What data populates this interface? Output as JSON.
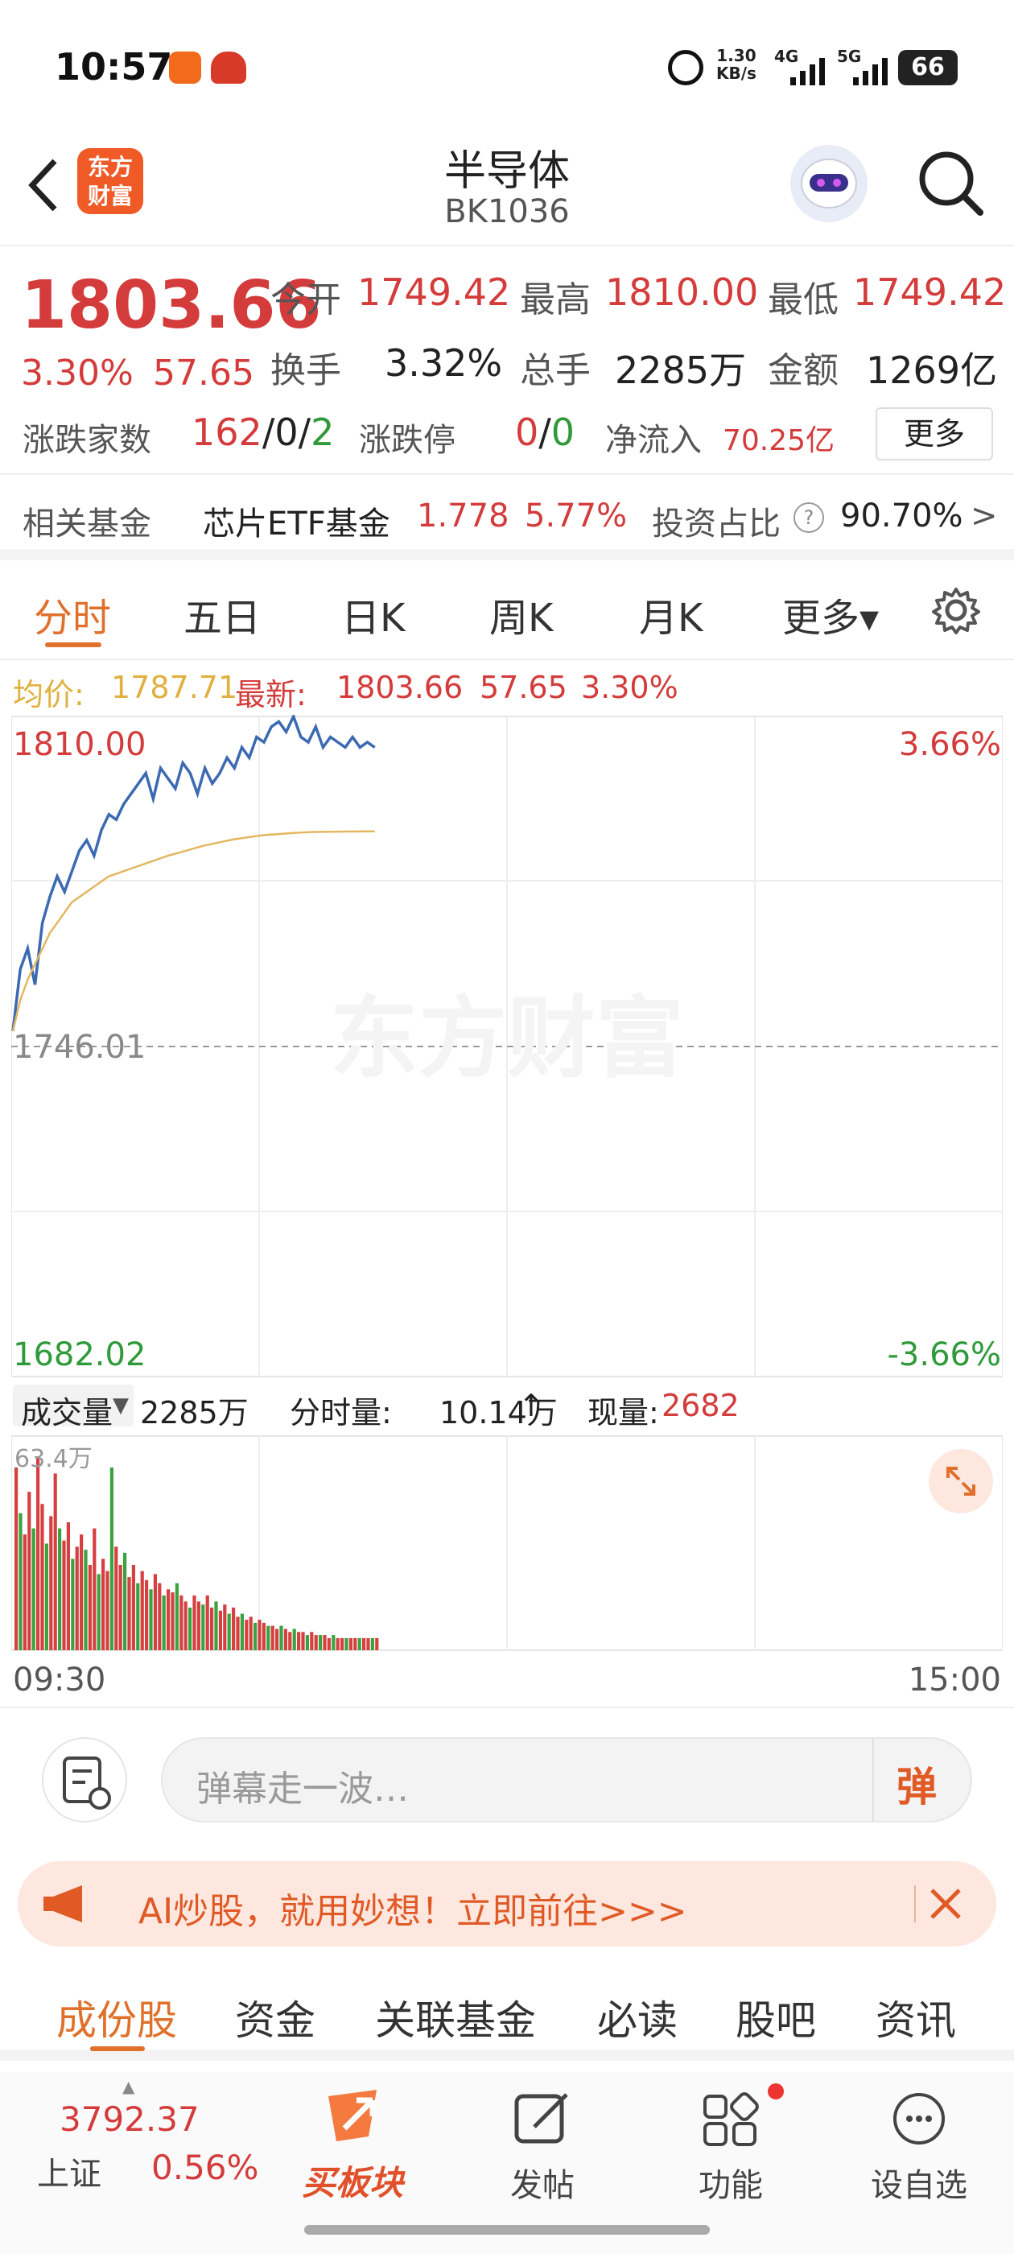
{
  "status": {
    "time": "10:57",
    "speed": "1.30",
    "speed_unit": "KB/s",
    "net1": "4G",
    "net2": "5G",
    "battery": "66"
  },
  "nav": {
    "logo": "东方财富",
    "title": "半导体",
    "code": "BK1036"
  },
  "quote": {
    "price": "1803.66",
    "change_pct": "3.30%",
    "change": "57.65",
    "open_label": "今开",
    "open": "1749.42",
    "high_label": "最高",
    "high": "1810.00",
    "low_label": "最低",
    "low": "1749.42",
    "turnover_label": "换手",
    "turnover": "3.32%",
    "volume_label": "总手",
    "volume": "2285万",
    "amount_label": "金额",
    "amount": "1269亿",
    "updown_label": "涨跌家数",
    "up": "162",
    "flat": "0",
    "down": "2",
    "slash": "/",
    "limit_label": "涨跌停",
    "limit_up": "0",
    "limit_down": "0",
    "netflow_label": "净流入",
    "netflow": "70.25亿",
    "more_button": "更多"
  },
  "fund": {
    "label": "相关基金",
    "name": "芯片ETF基金",
    "price": "1.778",
    "pct": "5.77%",
    "ratio_label": "投资占比",
    "help": "?",
    "ratio": "90.70%",
    "arrow": ">"
  },
  "tabs": [
    {
      "label": "分时"
    },
    {
      "label": "五日"
    },
    {
      "label": "日K"
    },
    {
      "label": "周K"
    },
    {
      "label": "月K"
    },
    {
      "label": "更多▾"
    }
  ],
  "priceinfo": {
    "avg_label": "均价:",
    "avg": "1787.71",
    "latest_label": "最新:",
    "latest": "1803.66",
    "change": "57.65",
    "pct": "3.30%"
  },
  "chart_data": {
    "type": "line",
    "y_high_label": "1810.00",
    "y_mid_label": "1746.01",
    "y_low_label": "1682.02",
    "pct_high_label": "3.66%",
    "pct_low_label": "-3.66%",
    "ylim": [
      1682.02,
      1810.0
    ],
    "watermark": "东方财富",
    "series": [
      {
        "name": "最新",
        "color": "#3b6ab3",
        "values": [
          1749,
          1761,
          1765,
          1758,
          1770,
          1775,
          1779,
          1776,
          1780,
          1784,
          1786,
          1783,
          1788,
          1791,
          1790,
          1793,
          1795,
          1797,
          1799,
          1794,
          1800,
          1798,
          1796,
          1801,
          1799,
          1795,
          1800,
          1797,
          1799,
          1802,
          1800,
          1804,
          1802,
          1806,
          1805,
          1808,
          1809,
          1807,
          1810,
          1806,
          1805,
          1808,
          1804,
          1806,
          1805,
          1804,
          1806,
          1804,
          1805,
          1804
        ]
      },
      {
        "name": "均价",
        "color": "#e3b760",
        "values": [
          1749,
          1755,
          1759,
          1762,
          1765,
          1768,
          1770,
          1772,
          1774,
          1775,
          1776,
          1777,
          1778,
          1779,
          1779.5,
          1780,
          1780.5,
          1781,
          1781.5,
          1782,
          1782.5,
          1783,
          1783.4,
          1783.8,
          1784.2,
          1784.6,
          1785,
          1785.3,
          1785.6,
          1785.9,
          1786.2,
          1786.4,
          1786.6,
          1786.8,
          1787,
          1787.1,
          1787.2,
          1787.3,
          1787.4,
          1787.5,
          1787.55,
          1787.6,
          1787.62,
          1787.64,
          1787.66,
          1787.68,
          1787.69,
          1787.7,
          1787.71,
          1787.71
        ]
      }
    ]
  },
  "vol": {
    "label": "成交量",
    "total": "2285万",
    "minute_label": "分时量:",
    "minute": "10.14万",
    "minute_arrow": "↑",
    "current_label": "现量:",
    "current": "2682",
    "max_label": "63.4万",
    "bars": [
      60,
      45,
      38,
      52,
      40,
      63,
      48,
      35,
      44,
      58,
      40,
      36,
      42,
      30,
      34,
      38,
      33,
      28,
      40,
      25,
      30,
      26,
      60,
      34,
      28,
      32,
      24,
      28,
      22,
      26,
      23,
      20,
      25,
      22,
      18,
      20,
      19,
      22,
      18,
      16,
      14,
      18,
      16,
      15,
      18,
      14,
      16,
      13,
      15,
      12,
      14,
      11,
      12,
      10,
      11,
      9,
      10,
      9,
      8,
      8,
      7,
      8,
      7,
      6,
      7,
      6,
      6,
      5,
      6,
      5,
      5,
      5,
      4,
      5,
      4,
      4,
      4,
      4,
      4,
      4,
      4,
      4,
      4,
      4
    ],
    "bar_colors": "alt"
  },
  "times": {
    "start": "09:30",
    "end": "15:00"
  },
  "comment": {
    "placeholder": "弹幕走一波…",
    "dm": "弹"
  },
  "banner": {
    "text": "AI炒股，就用妙想！立即前往>>>"
  },
  "subtabs": [
    {
      "label": "成份股"
    },
    {
      "label": "资金"
    },
    {
      "label": "关联基金"
    },
    {
      "label": "必读"
    },
    {
      "label": "股吧"
    },
    {
      "label": "资讯"
    }
  ],
  "bottom": {
    "index_value": "3792.37",
    "index_name": "上证",
    "index_pct": "0.56%",
    "buy": "买板块",
    "post": "发帖",
    "func": "功能",
    "watch": "设自选"
  }
}
